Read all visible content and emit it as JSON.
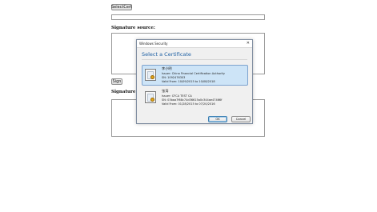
{
  "page": {
    "select_cert_button": "SelectCert",
    "signature_source_label": "Signature source:",
    "sign_button": "Sign",
    "signature_label": "Signature"
  },
  "dialog": {
    "window_title": "Windows Security",
    "close_glyph": "✕",
    "heading": "Select a Certificate",
    "ok_label": "OK",
    "cancel_label": "Cancel",
    "certificates": [
      {
        "name": "李小明",
        "issuer": "Issuer: China Financial Certification Authority",
        "sn": "SN: 1092476303",
        "valid": "Valid From: 10/09/2015 to 10/08/2018",
        "selected": true
      },
      {
        "name": "张涛",
        "issuer": "Issuer: CFCA TEST CA",
        "sn": "SN: 03baa7f68c74d36615a0c344ae47466f",
        "valid": "Valid From: 01/28/2015 to 07/20/2016",
        "selected": false
      }
    ]
  },
  "colors": {
    "dialog_heading": "#1d5fa3",
    "selection_bg": "#cde4f7",
    "icon": "certificate-icon"
  }
}
